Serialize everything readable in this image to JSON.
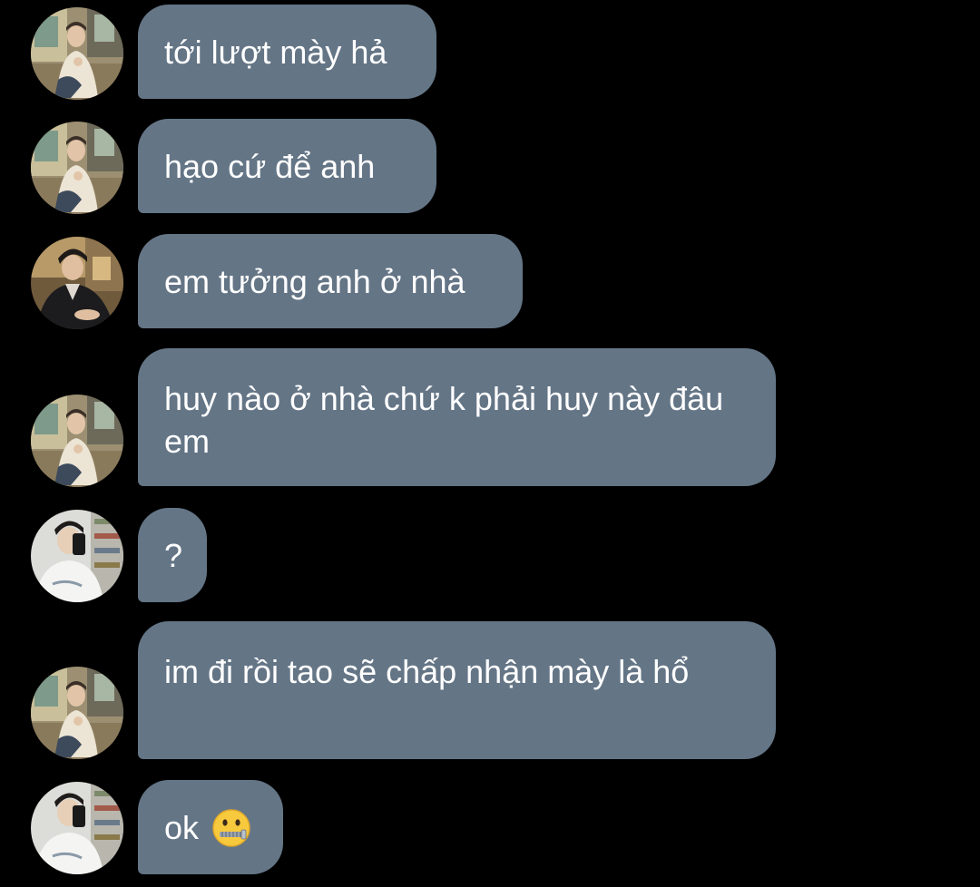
{
  "messages": [
    {
      "sender": "avatar-a",
      "text": "tới lượt mày hả"
    },
    {
      "sender": "avatar-a",
      "text": "hạo cứ để anh"
    },
    {
      "sender": "avatar-b",
      "text": "em tưởng anh ở nhà"
    },
    {
      "sender": "avatar-a",
      "text": "huy nào ở nhà chứ k phải huy này đâu em"
    },
    {
      "sender": "avatar-c",
      "text": "?"
    },
    {
      "sender": "avatar-a",
      "text": "im đi rồi tao sẽ chấp nhận mày là hổ"
    },
    {
      "sender": "avatar-c",
      "text": "ok",
      "emoji": "zipper-mouth-face-icon"
    }
  ],
  "colors": {
    "background": "#000000",
    "bubble": "#647586",
    "text": "#ffffff"
  }
}
